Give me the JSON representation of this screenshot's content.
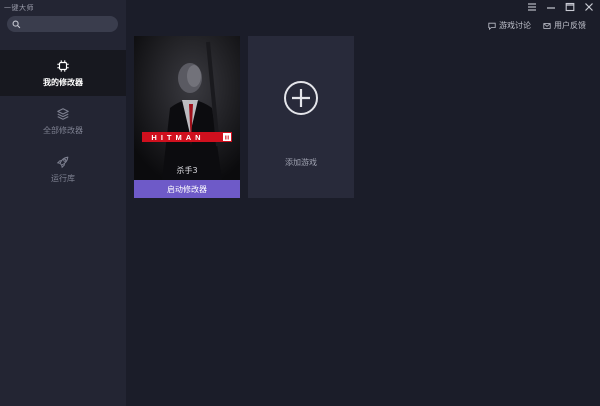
{
  "app": {
    "title": "一键大师"
  },
  "search": {
    "placeholder": "",
    "value": ""
  },
  "sidebar": {
    "items": [
      {
        "label": "我的修改器",
        "icon": "chip-icon",
        "active": true
      },
      {
        "label": "全部修改器",
        "icon": "layers-icon",
        "active": false
      },
      {
        "label": "运行库",
        "icon": "rocket-icon",
        "active": false
      }
    ]
  },
  "window_controls": [
    "menu-icon",
    "minimize-icon",
    "maximize-icon",
    "close-icon"
  ],
  "header": {
    "links": [
      {
        "label": "游戏讨论",
        "icon": "chat-icon"
      },
      {
        "label": "用户反馈",
        "icon": "mail-icon"
      }
    ]
  },
  "games": [
    {
      "poster_title": "HITMAN",
      "poster_badge": "III",
      "name": "杀手3",
      "button_label": "启动修改器"
    }
  ],
  "add_game": {
    "label": "添加游戏"
  },
  "colors": {
    "accent": "#6e5ac8",
    "sidebar": "#232533",
    "background": "#1b1d29",
    "active_item": "#17181f",
    "poster_red": "#d0101e"
  }
}
